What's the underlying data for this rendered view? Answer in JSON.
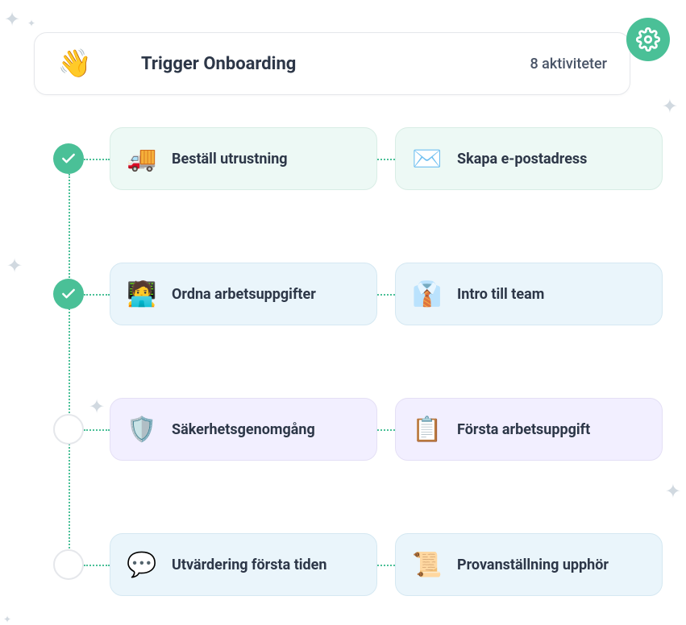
{
  "trigger": {
    "title": "Trigger Onboarding",
    "count": "8 aktiviteter",
    "icon": "👋"
  },
  "rows": [
    {
      "done": true,
      "left": {
        "icon": "🚚",
        "label": "Beställ utrustning",
        "theme": "mint"
      },
      "right": {
        "icon": "✉️",
        "label": "Skapa e-postadress",
        "theme": "mint"
      }
    },
    {
      "done": true,
      "left": {
        "icon": "🧑‍💻",
        "label": "Ordna arbetsuppgifter",
        "theme": "blue"
      },
      "right": {
        "icon": "👔",
        "label": "Intro till team",
        "theme": "blue"
      }
    },
    {
      "done": false,
      "left": {
        "icon": "🛡️",
        "label": "Säkerhetsgenomgång",
        "theme": "lavender"
      },
      "right": {
        "icon": "📋",
        "label": "Första arbetsuppgift",
        "theme": "lavender"
      }
    },
    {
      "done": false,
      "left": {
        "icon": "💬",
        "label": "Utvärdering första tiden",
        "theme": "blue"
      },
      "right": {
        "icon": "📜",
        "label": "Provanställning upphör",
        "theme": "blue"
      }
    }
  ]
}
